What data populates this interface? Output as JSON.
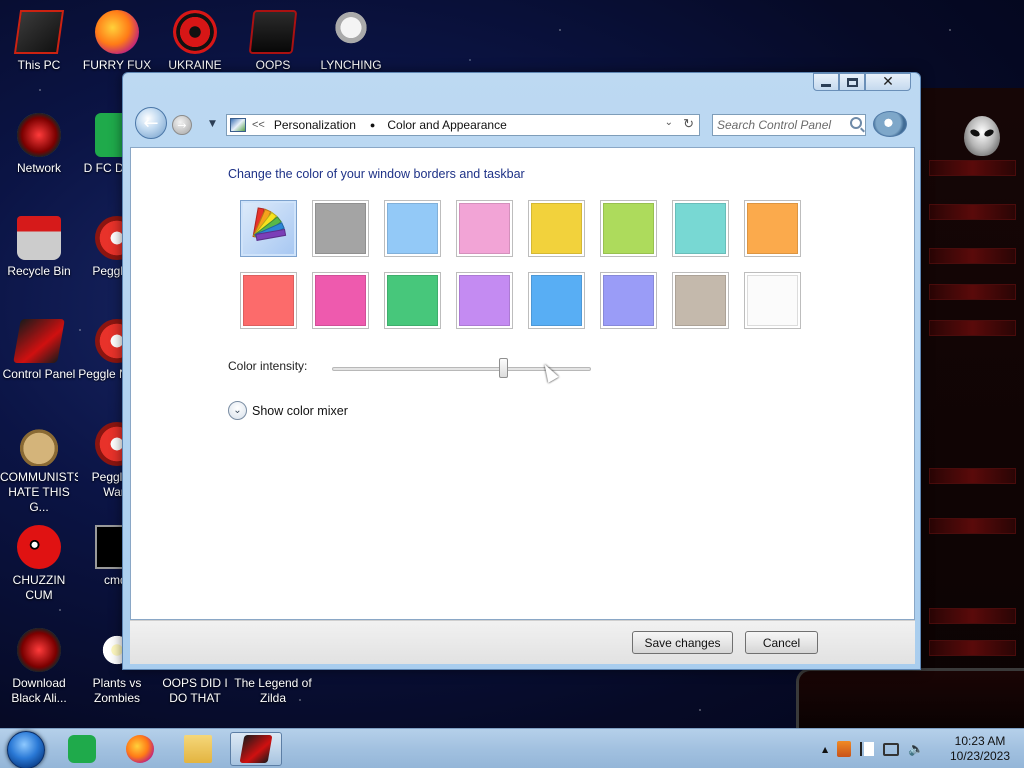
{
  "desktop": {
    "icons": [
      {
        "label": "This PC",
        "icon": "this-pc-icon"
      },
      {
        "label": "FURRY FUX",
        "icon": "firefox-icon"
      },
      {
        "label": "UKRAINE",
        "icon": "radiation-icon"
      },
      {
        "label": "OOPS",
        "icon": "alienware-laptop-icon"
      },
      {
        "label": "LYNCHING",
        "icon": "noose-icon"
      },
      {
        "label": "Network",
        "icon": "network-icon"
      },
      {
        "label": "D FC DUMB",
        "icon": "green-doc-icon"
      },
      {
        "label": "Recycle Bin",
        "icon": "recycle-bin-icon"
      },
      {
        "label": "Peggle D",
        "icon": "peggle-icon"
      },
      {
        "label": "Control Panel",
        "icon": "control-panel-icon"
      },
      {
        "label": "Peggle N Delu",
        "icon": "peggle-icon"
      },
      {
        "label": "COMMUNISTS HATE THIS G...",
        "icon": "money-bag-icon"
      },
      {
        "label": "Peggle of Warc",
        "icon": "peggle-icon"
      },
      {
        "label": "CHUZZIN CUM",
        "icon": "chuzzle-icon"
      },
      {
        "label": "cmd.",
        "icon": "cmd-icon"
      },
      {
        "label": "Download Black Ali...",
        "icon": "alien-orb-icon"
      },
      {
        "label": "Plants vs Zombies",
        "icon": "pvz-icon"
      },
      {
        "label": "OOPS DID I DO THAT",
        "icon": "blank-icon"
      },
      {
        "label": "The Legend of Zilda",
        "icon": "blank-icon"
      }
    ]
  },
  "window": {
    "breadcrumb": {
      "prefix": "<<",
      "items": [
        "Personalization",
        "Color and Appearance"
      ]
    },
    "search_placeholder": "Search Control Panel",
    "heading": "Change the color of your window borders and taskbar",
    "swatches": {
      "row1": [
        {
          "name": "custom",
          "color": "custom",
          "selected": true
        },
        {
          "name": "gray",
          "color": "#a4a4a4"
        },
        {
          "name": "sky",
          "color": "#93c9f7"
        },
        {
          "name": "pink",
          "color": "#f2a4d6"
        },
        {
          "name": "yellow",
          "color": "#f2d23c"
        },
        {
          "name": "lime",
          "color": "#addb5c"
        },
        {
          "name": "teal",
          "color": "#78d8d3"
        },
        {
          "name": "orange",
          "color": "#fbaa4c"
        }
      ],
      "row2": [
        {
          "name": "red",
          "color": "#fc6b6b"
        },
        {
          "name": "magenta",
          "color": "#ee5aae"
        },
        {
          "name": "green",
          "color": "#47c77b"
        },
        {
          "name": "violet",
          "color": "#c48bf2"
        },
        {
          "name": "blue",
          "color": "#58aef4"
        },
        {
          "name": "lavender",
          "color": "#9a9cf7"
        },
        {
          "name": "taupe",
          "color": "#c4b9ac"
        },
        {
          "name": "white",
          "color": "#fbfbfb"
        }
      ]
    },
    "intensity_label": "Color intensity:",
    "intensity_value": 0.66,
    "mixer_label": "Show color mixer",
    "save_label": "Save changes",
    "cancel_label": "Cancel"
  },
  "taskbar": {
    "pinned": [
      "start-orb-icon",
      "green-doc-icon",
      "firefox-icon",
      "folder-icon",
      "alienware-laptop-icon"
    ],
    "time": "10:23 AM",
    "date": "10/23/2023"
  },
  "colors": {
    "window_frame": "#a9cdee",
    "heading_text": "#1e3287",
    "taskbar": "#a2c1e0"
  }
}
